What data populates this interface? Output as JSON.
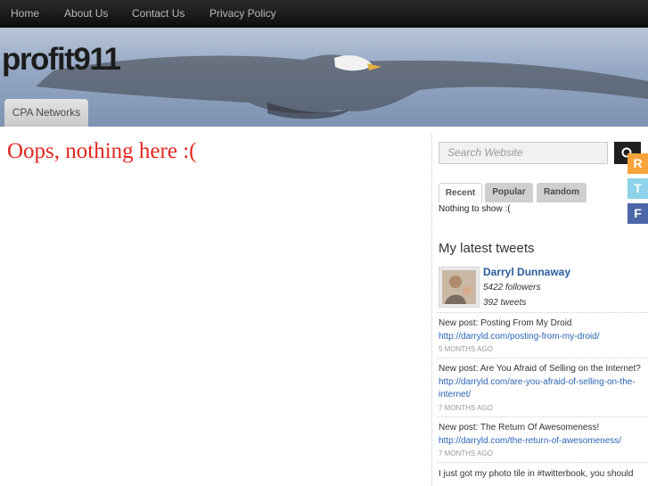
{
  "nav": {
    "items": [
      {
        "label": "Home"
      },
      {
        "label": "About Us"
      },
      {
        "label": "Contact Us"
      },
      {
        "label": "Privacy Policy"
      }
    ]
  },
  "header": {
    "site_title": "profit911",
    "tab_label": "CPA Networks"
  },
  "main": {
    "message": "Oops, nothing here :("
  },
  "sidebar": {
    "search_placeholder": "Search Website",
    "social": [
      "R",
      "T",
      "F"
    ],
    "tabs": [
      {
        "label": "Recent"
      },
      {
        "label": "Popular"
      },
      {
        "label": "Random"
      }
    ],
    "tab_content": "Nothing to show :(",
    "tweets_heading": "My latest tweets",
    "profile": {
      "name": "Darryl Dunnaway",
      "followers": "5422 followers",
      "tweets": "392 tweets"
    },
    "tweets": [
      {
        "text": "New post: Posting From My Droid",
        "link": "http://darryld.com/posting-from-my-droid/",
        "link2": "",
        "time": "5 MONTHS AGO"
      },
      {
        "text": "New post: Are You Afraid of Selling on the Internet?",
        "link": "http://darryld.com/are-you-afraid-of-selling-on-the-",
        "link2": "internet/",
        "time": "7 MONTHS AGO"
      },
      {
        "text": "New post: The Return Of Awesomeness!",
        "link": "http://darryld.com/the-return-of-awesomeness/",
        "link2": "",
        "time": "7 MONTHS AGO"
      },
      {
        "text": "I just got my photo tile in #twitterbook, you should",
        "link": "",
        "link2": "",
        "time": ""
      }
    ]
  },
  "colors": {
    "accent_red": "#e3271f",
    "link_blue": "#2c63b5",
    "social_rss": "#f7a33c",
    "social_twitter": "#8fd3ea",
    "social_facebook": "#4b67a8"
  }
}
